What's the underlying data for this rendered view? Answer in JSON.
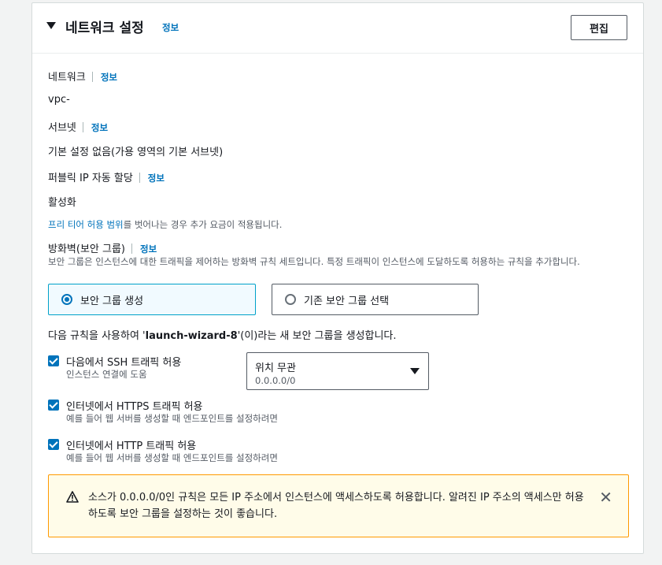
{
  "section": {
    "title": "네트워크 설정",
    "info": "정보",
    "edit_label": "편집"
  },
  "network": {
    "label": "네트워크",
    "info": "정보",
    "value": "vpc-"
  },
  "subnet": {
    "label": "서브넷",
    "info": "정보",
    "value": "기본 설정 없음(가용 영역의 기본 서브넷)"
  },
  "public_ip": {
    "label": "퍼블릭 IP 자동 할당",
    "info": "정보",
    "value": "활성화"
  },
  "free_tier": {
    "link": "프리 티어 허용 범위",
    "text": "를 벗어나는 경우 추가 요금이 적용됩니다."
  },
  "firewall": {
    "label": "방화벽(보안 그룹)",
    "info": "정보",
    "desc": "보안 그룹은 인스턴스에 대한 트래픽을 제어하는 방화벽 규칙 세트입니다. 특정 트래픽이 인스턴스에 도달하도록 허용하는 규칙을 추가합니다.",
    "option_create": "보안 그룹 생성",
    "option_existing": "기존 보안 그룹 선택",
    "rules_prefix": "다음 규칙을 사용하여 '",
    "group_name": "launch-wizard-8",
    "rules_suffix": "'(이)라는 새 보안 그룹을 생성합니다."
  },
  "rules": {
    "ssh_label": "다음에서 SSH 트래픽 허용",
    "ssh_desc": "인스턴스 연결에 도움",
    "ssh_source": "위치 무관",
    "ssh_source_sub": "0.0.0.0/0",
    "https_label": "인터넷에서 HTTPS 트래픽 허용",
    "https_desc": "예를 들어 웹 서버를 생성할 때 엔드포인트를 설정하려면",
    "http_label": "인터넷에서 HTTP 트래픽 허용",
    "http_desc": "예를 들어 웹 서버를 생성할 때 엔드포인트를 설정하려면"
  },
  "alert": {
    "text": "소스가 0.0.0.0/0인 규칙은 모든 IP 주소에서 인스턴스에 액세스하도록 허용합니다. 알려진 IP 주소의 액세스만 허용하도록 보안 그룹을 설정하는 것이 좋습니다.",
    "icon": "warning-icon"
  },
  "colors": {
    "link": "#0073bb",
    "selected_border": "#00a1c9",
    "alert_border": "#ff9900",
    "alert_bg": "#fffce9"
  }
}
